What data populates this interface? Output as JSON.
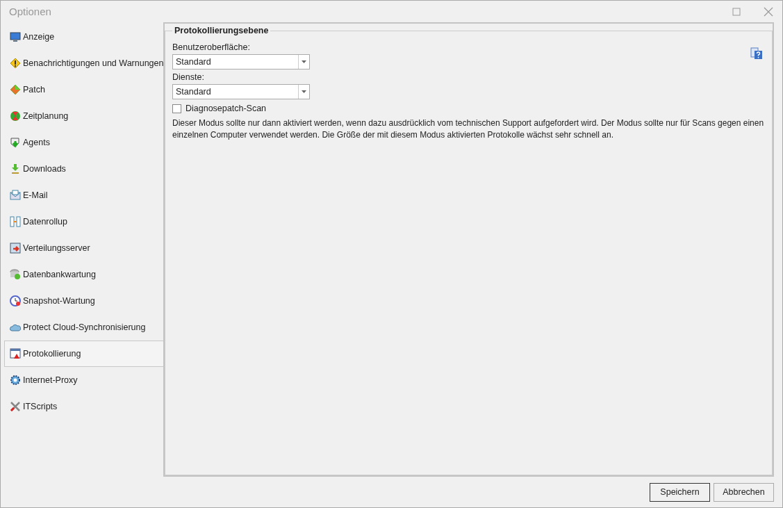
{
  "window": {
    "title": "Optionen"
  },
  "sidebar": {
    "items": [
      {
        "label": "Anzeige",
        "selected": false
      },
      {
        "label": "Benachrichtigungen und Warnungen",
        "selected": false
      },
      {
        "label": "Patch",
        "selected": false
      },
      {
        "label": "Zeitplanung",
        "selected": false
      },
      {
        "label": "Agents",
        "selected": false
      },
      {
        "label": "Downloads",
        "selected": false
      },
      {
        "label": "E-Mail",
        "selected": false
      },
      {
        "label": "Datenrollup",
        "selected": false
      },
      {
        "label": "Verteilungsserver",
        "selected": false
      },
      {
        "label": "Datenbankwartung",
        "selected": false
      },
      {
        "label": "Snapshot-Wartung",
        "selected": false
      },
      {
        "label": "Protect Cloud-Synchronisierung",
        "selected": false
      },
      {
        "label": "Protokollierung",
        "selected": true
      },
      {
        "label": "Internet-Proxy",
        "selected": false
      },
      {
        "label": "ITScripts",
        "selected": false
      }
    ]
  },
  "group": {
    "title": "Protokollierungsebene",
    "fields": [
      {
        "label": "Benutzeroberfläche:",
        "value": "Standard"
      },
      {
        "label": "Dienste:",
        "value": "Standard"
      }
    ],
    "checkbox": {
      "label": "Diagnosepatch-Scan",
      "checked": false
    },
    "description": "Dieser Modus sollte nur dann aktiviert werden, wenn dazu ausdrücklich vom technischen Support aufgefordert wird. Der Modus sollte nur für Scans gegen einen einzelnen Computer verwendet werden. Die Größe der mit diesem Modus aktivierten Protokolle wächst sehr schnell an."
  },
  "buttons": [
    {
      "label": "Speichern",
      "kind": "default"
    },
    {
      "label": "Abbrechen",
      "kind": "normal"
    }
  ]
}
